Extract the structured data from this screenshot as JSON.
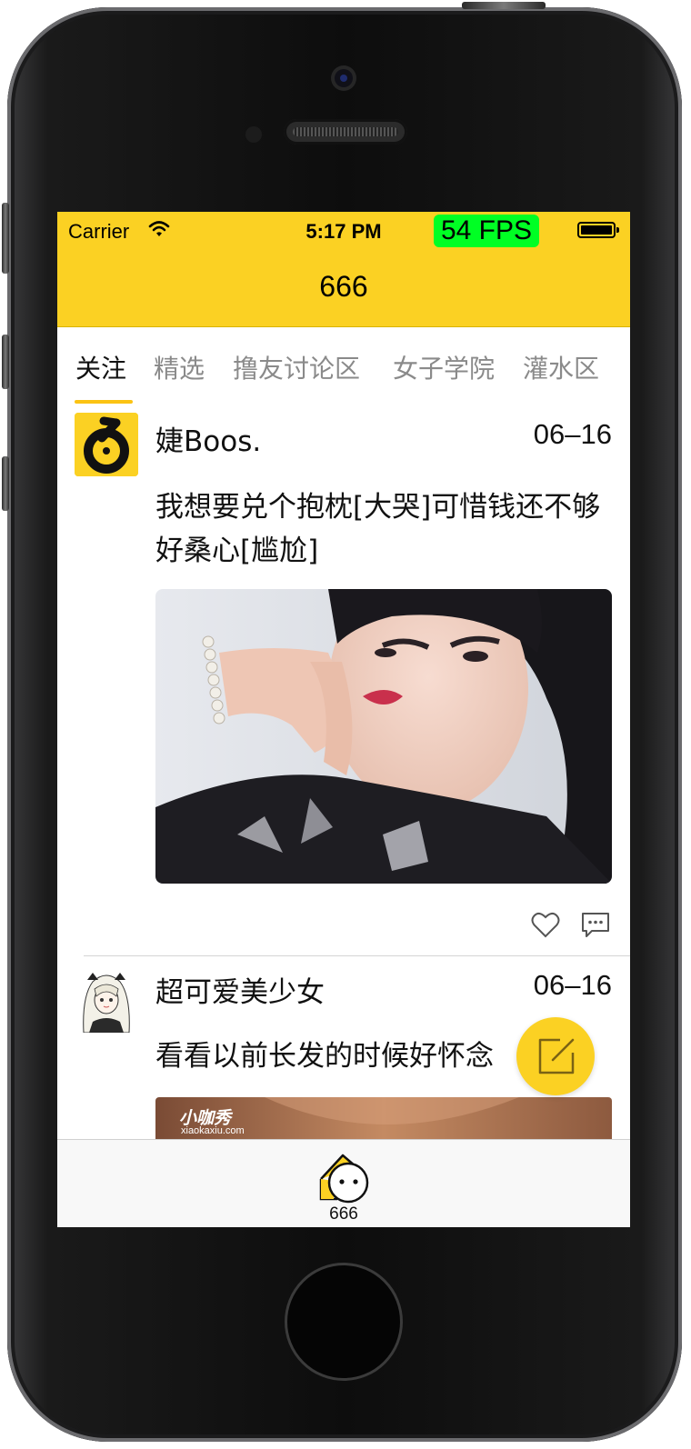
{
  "status_bar": {
    "carrier": "Carrier",
    "time": "5:17 PM",
    "fps": "54 FPS"
  },
  "nav": {
    "title": "666"
  },
  "tabs": [
    {
      "label": "关注",
      "active": true
    },
    {
      "label": "精选",
      "active": false
    },
    {
      "label": "撸友讨论区",
      "active": false
    },
    {
      "label": "女子学院",
      "active": false
    },
    {
      "label": "灌水区",
      "active": false
    }
  ],
  "posts": [
    {
      "author": "婕Boos.",
      "date": "06–16",
      "text": "我想要兑个抱枕[大哭]可惜钱还不够好桑心[尴尬]",
      "avatar_icon": "six-logo-icon"
    },
    {
      "author": "超可爱美少女",
      "date": "06–16",
      "text": "看看以前长发的时候好怀念",
      "avatar_icon": "anime-girl-avatar",
      "photo_watermark": "小咖秀",
      "photo_watermark_url": "xiaokaxiu.com"
    }
  ],
  "tab_bar": {
    "home_label": "666"
  },
  "colors": {
    "accent": "#fbd123",
    "fps_bg": "#00ff24"
  }
}
